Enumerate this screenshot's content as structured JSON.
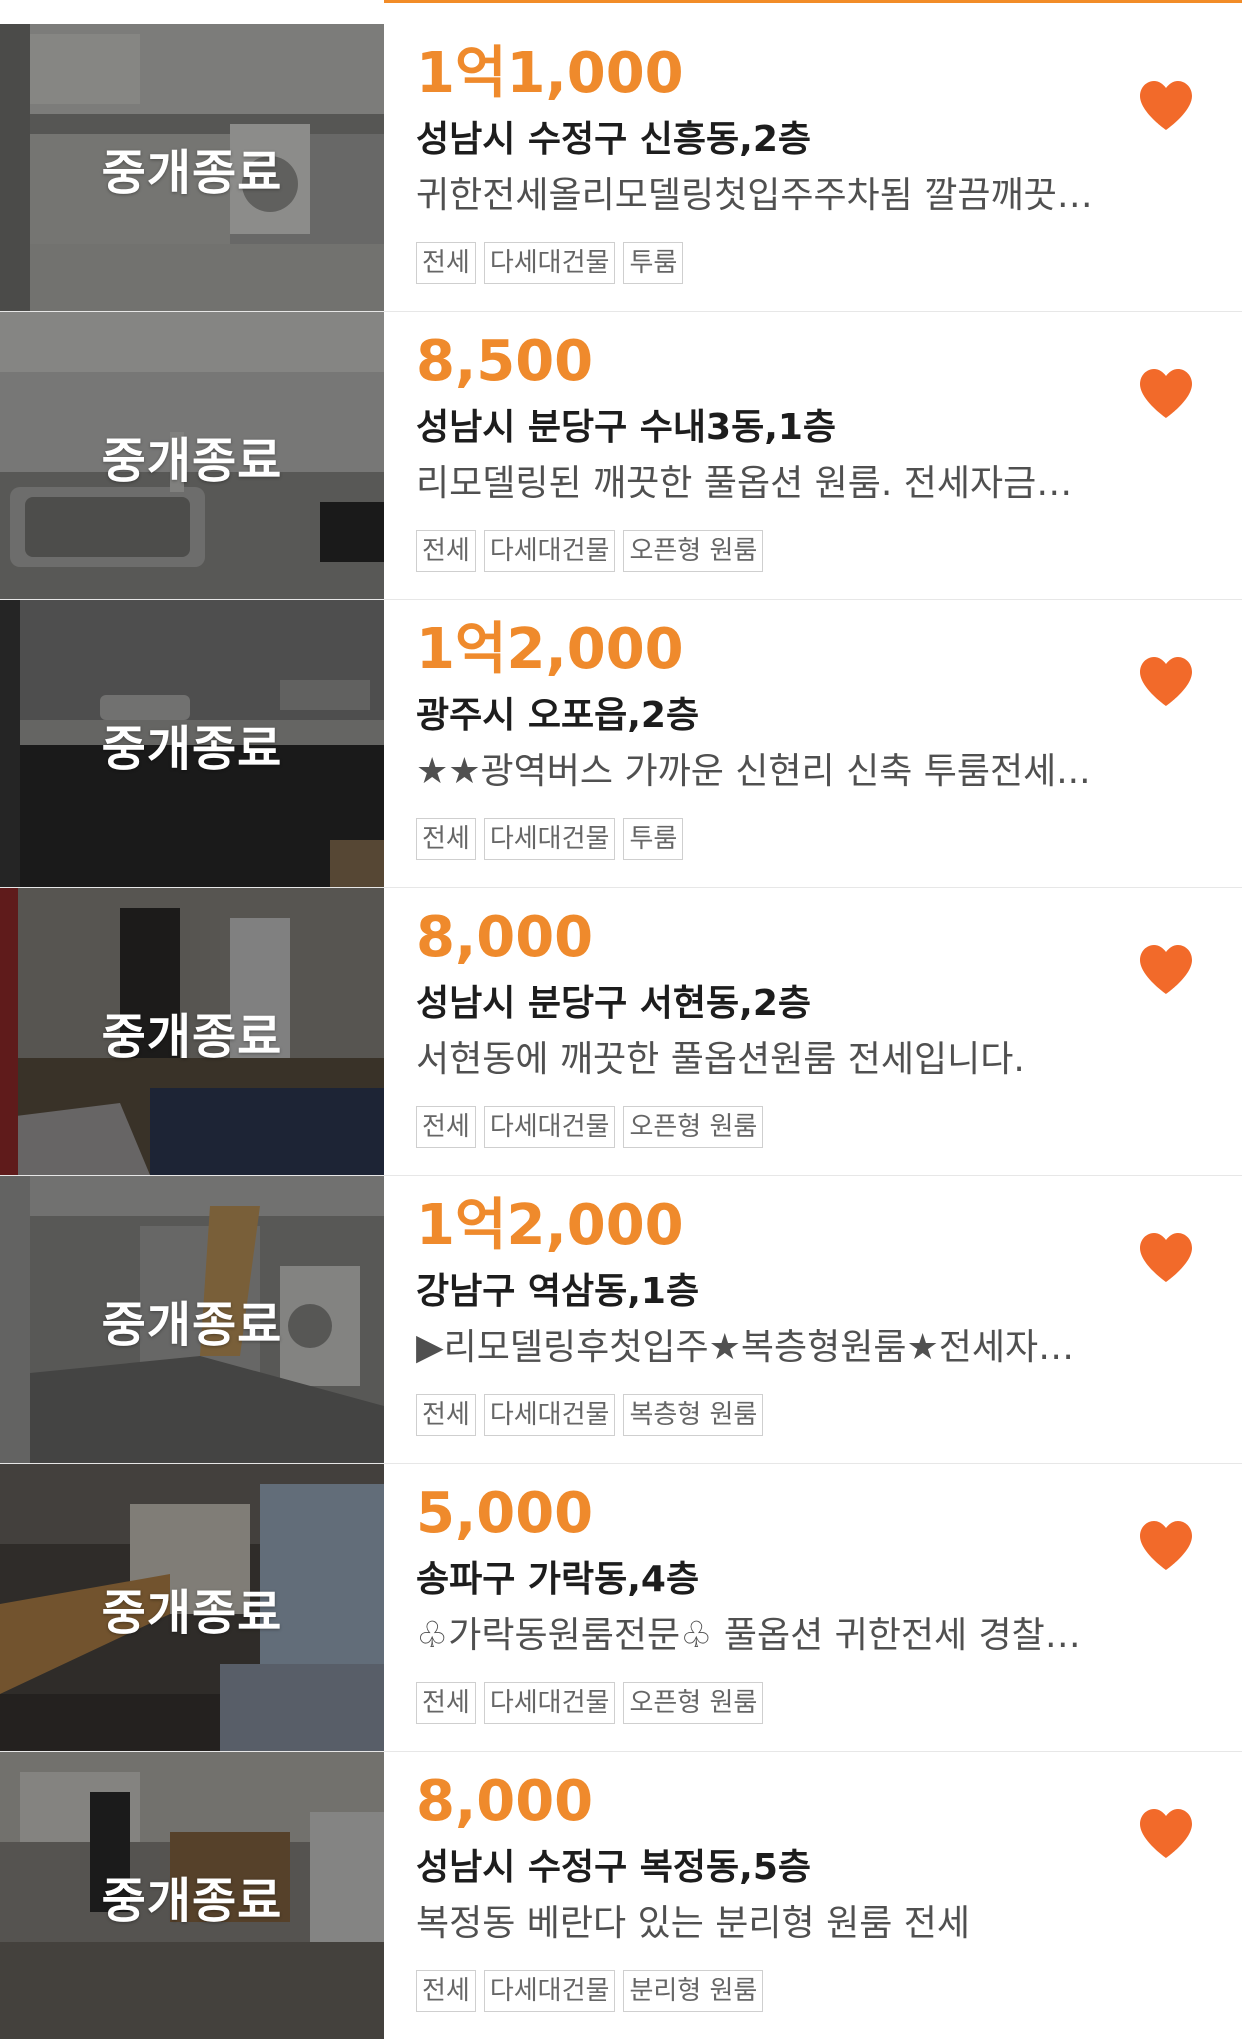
{
  "accent_color": "#ef8a2c",
  "heart_color": "#f26a2a",
  "listings": [
    {
      "status": "중개종료",
      "price": "1억1,000",
      "location": "성남시 수정구 신흥동,2층",
      "description": "귀한전세올리모델링첫입주주차됨 깔끔깨끗…",
      "tags": [
        "전세",
        "다세대건물",
        "투룸"
      ],
      "favorite_icon": "heart-icon",
      "photo": "kitchen with washer"
    },
    {
      "status": "중개종료",
      "price": "8,500",
      "location": "성남시 분당구 수내3동,1층",
      "description": "리모델링된 깨끗한 풀옵션 원룸. 전세자금…",
      "tags": [
        "전세",
        "다세대건물",
        "오픈형 원룸"
      ],
      "favorite_icon": "heart-icon",
      "photo": "kitchen sink"
    },
    {
      "status": "중개종료",
      "price": "1억2,000",
      "location": "광주시 오포읍,2층",
      "description": "★★광역버스 가까운 신현리 신축 투룸전세...",
      "tags": [
        "전세",
        "다세대건물",
        "투룸"
      ],
      "favorite_icon": "heart-icon",
      "photo": "dark kitchen"
    },
    {
      "status": "중개종료",
      "price": "8,000",
      "location": "성남시 분당구 서현동,2층",
      "description": "서현동에 깨끗한 풀옵션원룸 전세입니다.",
      "tags": [
        "전세",
        "다세대건물",
        "오픈형 원룸"
      ],
      "favorite_icon": "heart-icon",
      "photo": "room with rug"
    },
    {
      "status": "중개종료",
      "price": "1억2,000",
      "location": "강남구 역삼동,1층",
      "description": "▶리모델링후첫입주★복층형원룸★전세자…",
      "tags": [
        "전세",
        "다세대건물",
        "복층형 원룸"
      ],
      "favorite_icon": "heart-icon",
      "photo": "duplex with stairs"
    },
    {
      "status": "중개종료",
      "price": "5,000",
      "location": "송파구 가락동,4층",
      "description": "♧가락동원룸전문♧ 풀옵션 귀한전세  경찰…",
      "tags": [
        "전세",
        "다세대건물",
        "오픈형 원룸"
      ],
      "favorite_icon": "heart-icon",
      "photo": "room with desk"
    },
    {
      "status": "중개종료",
      "price": "8,000",
      "location": "성남시 수정구 복정동,5층",
      "description": "복정동 베란다 있는   분리형 원룸 전세",
      "tags": [
        "전세",
        "다세대건물",
        "분리형 원룸"
      ],
      "favorite_icon": "heart-icon",
      "photo": "room with chair"
    }
  ]
}
